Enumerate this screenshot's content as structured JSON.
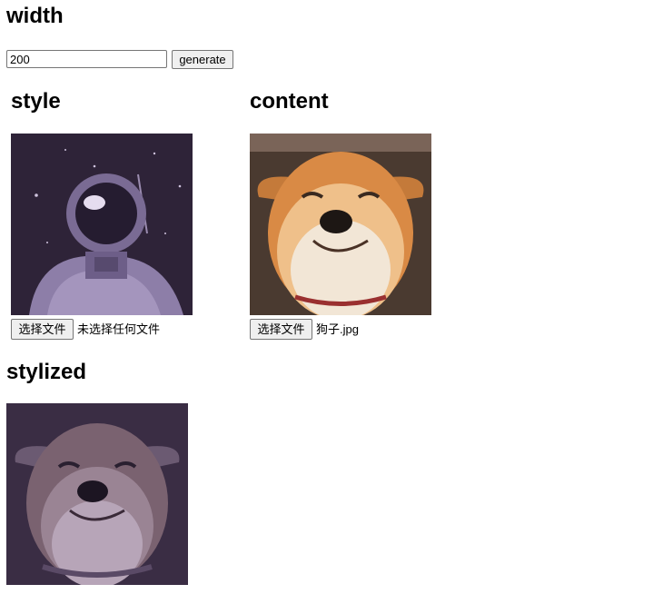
{
  "width_section": {
    "heading": "width",
    "input_value": "200",
    "generate_label": "generate"
  },
  "style_section": {
    "heading": "style",
    "file_button_label": "选择文件",
    "file_status": "未选择任何文件",
    "image_subject": "astronaut"
  },
  "content_section": {
    "heading": "content",
    "file_button_label": "选择文件",
    "file_status": "狗子.jpg",
    "image_subject": "shiba-dog"
  },
  "stylized_section": {
    "heading": "stylized",
    "image_subject": "stylized-shiba-dog"
  },
  "colors": {
    "style_bg": "#2e2338",
    "dog_fur": "#d98a45",
    "dog_cream": "#f2e6d6",
    "stylized_bg": "#3a2d44"
  }
}
